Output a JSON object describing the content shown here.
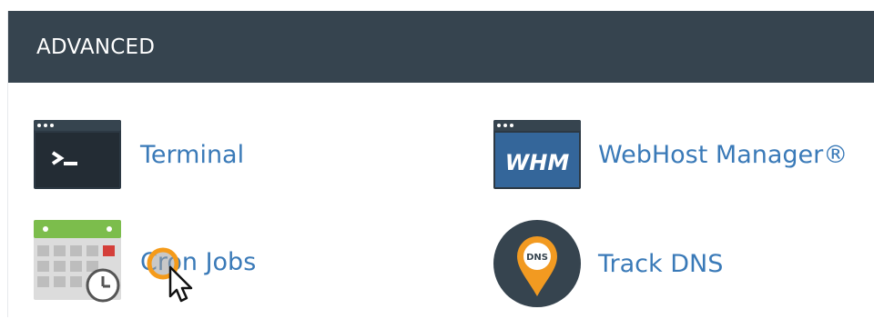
{
  "section": {
    "title": "ADVANCED"
  },
  "items": [
    {
      "id": "terminal",
      "label": "Terminal",
      "icon": "terminal-icon"
    },
    {
      "id": "whm",
      "label": "WebHost Manager®",
      "icon": "whm-icon",
      "icon_text": "WHM"
    },
    {
      "id": "cron",
      "label": "Cron Jobs",
      "icon": "calendar-clock-icon"
    },
    {
      "id": "dns",
      "label": "Track DNS",
      "icon": "dns-pin-icon",
      "icon_text": "DNS"
    }
  ],
  "colors": {
    "header_bg": "#36444f",
    "link": "#3a7ab8",
    "cursor_highlight": "#f59b1a"
  }
}
